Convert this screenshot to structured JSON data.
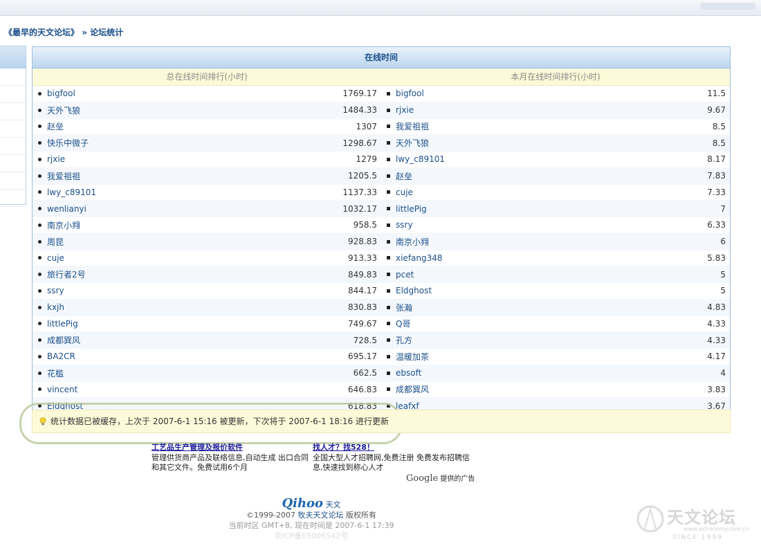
{
  "breadcrumb": {
    "forum": "《最早的天文论坛》",
    "sep": " » ",
    "current": "论坛统计"
  },
  "table": {
    "title": "在线时间",
    "total_header": "总在线时间排行(小时)",
    "month_header": "本月在线时间排行(小时)",
    "total": [
      {
        "name": "bigfool",
        "value": "1769.17"
      },
      {
        "name": "天外飞狼",
        "value": "1484.33"
      },
      {
        "name": "赵垒",
        "value": "1307"
      },
      {
        "name": "快乐中微子",
        "value": "1298.67"
      },
      {
        "name": "rjxie",
        "value": "1279"
      },
      {
        "name": "我爱祖祖",
        "value": "1205.5"
      },
      {
        "name": "lwy_c89101",
        "value": "1137.33"
      },
      {
        "name": "wenlianyi",
        "value": "1032.17"
      },
      {
        "name": "南京小翙",
        "value": "958.5"
      },
      {
        "name": "周昆",
        "value": "928.83"
      },
      {
        "name": "cuje",
        "value": "913.33"
      },
      {
        "name": "旅行者2号",
        "value": "849.83"
      },
      {
        "name": "ssry",
        "value": "844.17"
      },
      {
        "name": "kxjh",
        "value": "830.83"
      },
      {
        "name": "littlePig",
        "value": "749.67"
      },
      {
        "name": "成都巽风",
        "value": "728.5"
      },
      {
        "name": "BA2CR",
        "value": "695.17"
      },
      {
        "name": "花槛",
        "value": "662.5"
      },
      {
        "name": "vincent",
        "value": "646.83"
      },
      {
        "name": "Eldghost",
        "value": "618.83"
      }
    ],
    "month": [
      {
        "name": "bigfool",
        "value": "11.5"
      },
      {
        "name": "rjxie",
        "value": "9.67"
      },
      {
        "name": "我爱祖祖",
        "value": "8.5"
      },
      {
        "name": "天外飞狼",
        "value": "8.5"
      },
      {
        "name": "lwy_c89101",
        "value": "8.17"
      },
      {
        "name": "赵垒",
        "value": "7.83"
      },
      {
        "name": "cuje",
        "value": "7.33"
      },
      {
        "name": "littlePig",
        "value": "7"
      },
      {
        "name": "ssry",
        "value": "6.33"
      },
      {
        "name": "南京小翙",
        "value": "6"
      },
      {
        "name": "xiefang348",
        "value": "5.83"
      },
      {
        "name": "pcet",
        "value": "5"
      },
      {
        "name": "Eldghost",
        "value": "5"
      },
      {
        "name": "张瀚",
        "value": "4.83"
      },
      {
        "name": "Q哥",
        "value": "4.33"
      },
      {
        "name": "孔方",
        "value": "4.33"
      },
      {
        "name": "温暖加茶",
        "value": "4.17"
      },
      {
        "name": "ebsoft",
        "value": "4"
      },
      {
        "name": "成都巽风",
        "value": "3.83"
      },
      {
        "name": "leafxf",
        "value": "3.67"
      }
    ]
  },
  "notice": "统计数据已被缓存，上次于 2007-6-1 15:16 被更新，下次将于 2007-6-1 18:16 进行更新",
  "ads": [
    {
      "title": "工艺品生产管理及报价软件",
      "text": "管理供货商产品及联络信息,自动生成 出口合同和其它文件。免费试用6个月"
    },
    {
      "title": "找人才？找528！",
      "text": "全国大型人才招聘网,免费注册 免费发布招聘信息,快速找到称心人才"
    }
  ],
  "google": {
    "logo": "Google",
    "label": "提供的广告"
  },
  "footer": {
    "brand": "Qihoo",
    "brand_suffix": "天文",
    "copyright_pre": "©1999-2007 ",
    "copyright_link": "牧夫天文论坛",
    "copyright_post": " 版权所有",
    "time": "当前时区 GMT+8, 现在时间是 2007-6-1 17:39",
    "icp": "京ICP备05006542号"
  },
  "watermark": {
    "text": "天文论坛",
    "url": "www.astronomy.com.cn",
    "since": "SINCE 1999"
  },
  "colors": {
    "link": "#1b4f8a",
    "header_bg": "#bcd6f0",
    "notice_bg": "#fdfad9",
    "annotation": "#b8c89a"
  }
}
